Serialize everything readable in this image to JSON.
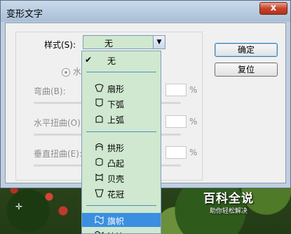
{
  "window": {
    "title": "变形文字",
    "close_glyph": "x"
  },
  "style": {
    "label": "样式(S):",
    "value": "无"
  },
  "orientation": {
    "horizontal_label_partial": "水平"
  },
  "params": [
    {
      "label": "弯曲(B):",
      "unit": "%"
    },
    {
      "label": "水平扭曲(O):",
      "unit": "%"
    },
    {
      "label": "垂直扭曲(E):",
      "unit": "%"
    }
  ],
  "buttons": {
    "ok": "确定",
    "reset": "复位"
  },
  "dropdown": {
    "check": "✔",
    "items": [
      "无",
      "扇形",
      "下弧",
      "上弧",
      "拱形",
      "凸起",
      "贝壳",
      "花冠",
      "旗帜",
      "波浪"
    ],
    "selected": "旗帜"
  },
  "watermark": {
    "title": "百科全说",
    "subtitle": "助你轻松解决"
  },
  "colors": {
    "dropdown_bg": "#cfe8cf",
    "selected_bg": "#3b8fe0",
    "titlebar": "#bfcfe0"
  }
}
